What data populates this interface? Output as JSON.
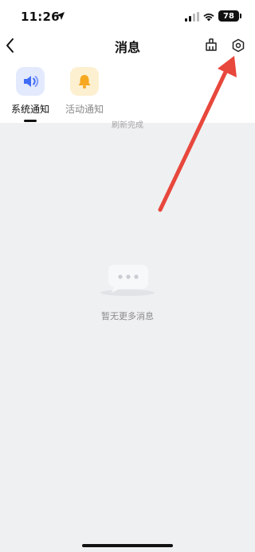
{
  "status_bar": {
    "time": "11:26",
    "battery": "78",
    "icons": [
      "location-arrow-icon",
      "signal-icon",
      "wifi-icon",
      "battery-icon"
    ]
  },
  "nav": {
    "title": "消息",
    "back_icon": "chevron-left-icon",
    "clean_icon": "broom-icon",
    "settings_icon": "hexagon-gear-icon"
  },
  "tabs": [
    {
      "label": "系统通知",
      "icon": "speaker-icon",
      "selected": true,
      "accent": "#3f6cf6"
    },
    {
      "label": "活动通知",
      "icon": "bell-icon",
      "selected": false,
      "accent": "#f6a821"
    }
  ],
  "content": {
    "refresh_hint": "刷新完成",
    "empty_text": "暂无更多消息",
    "illustration": "chat-bubble-icon"
  },
  "annotation": {
    "arrow_color": "#e8473c",
    "points_to": "settings-icon"
  }
}
